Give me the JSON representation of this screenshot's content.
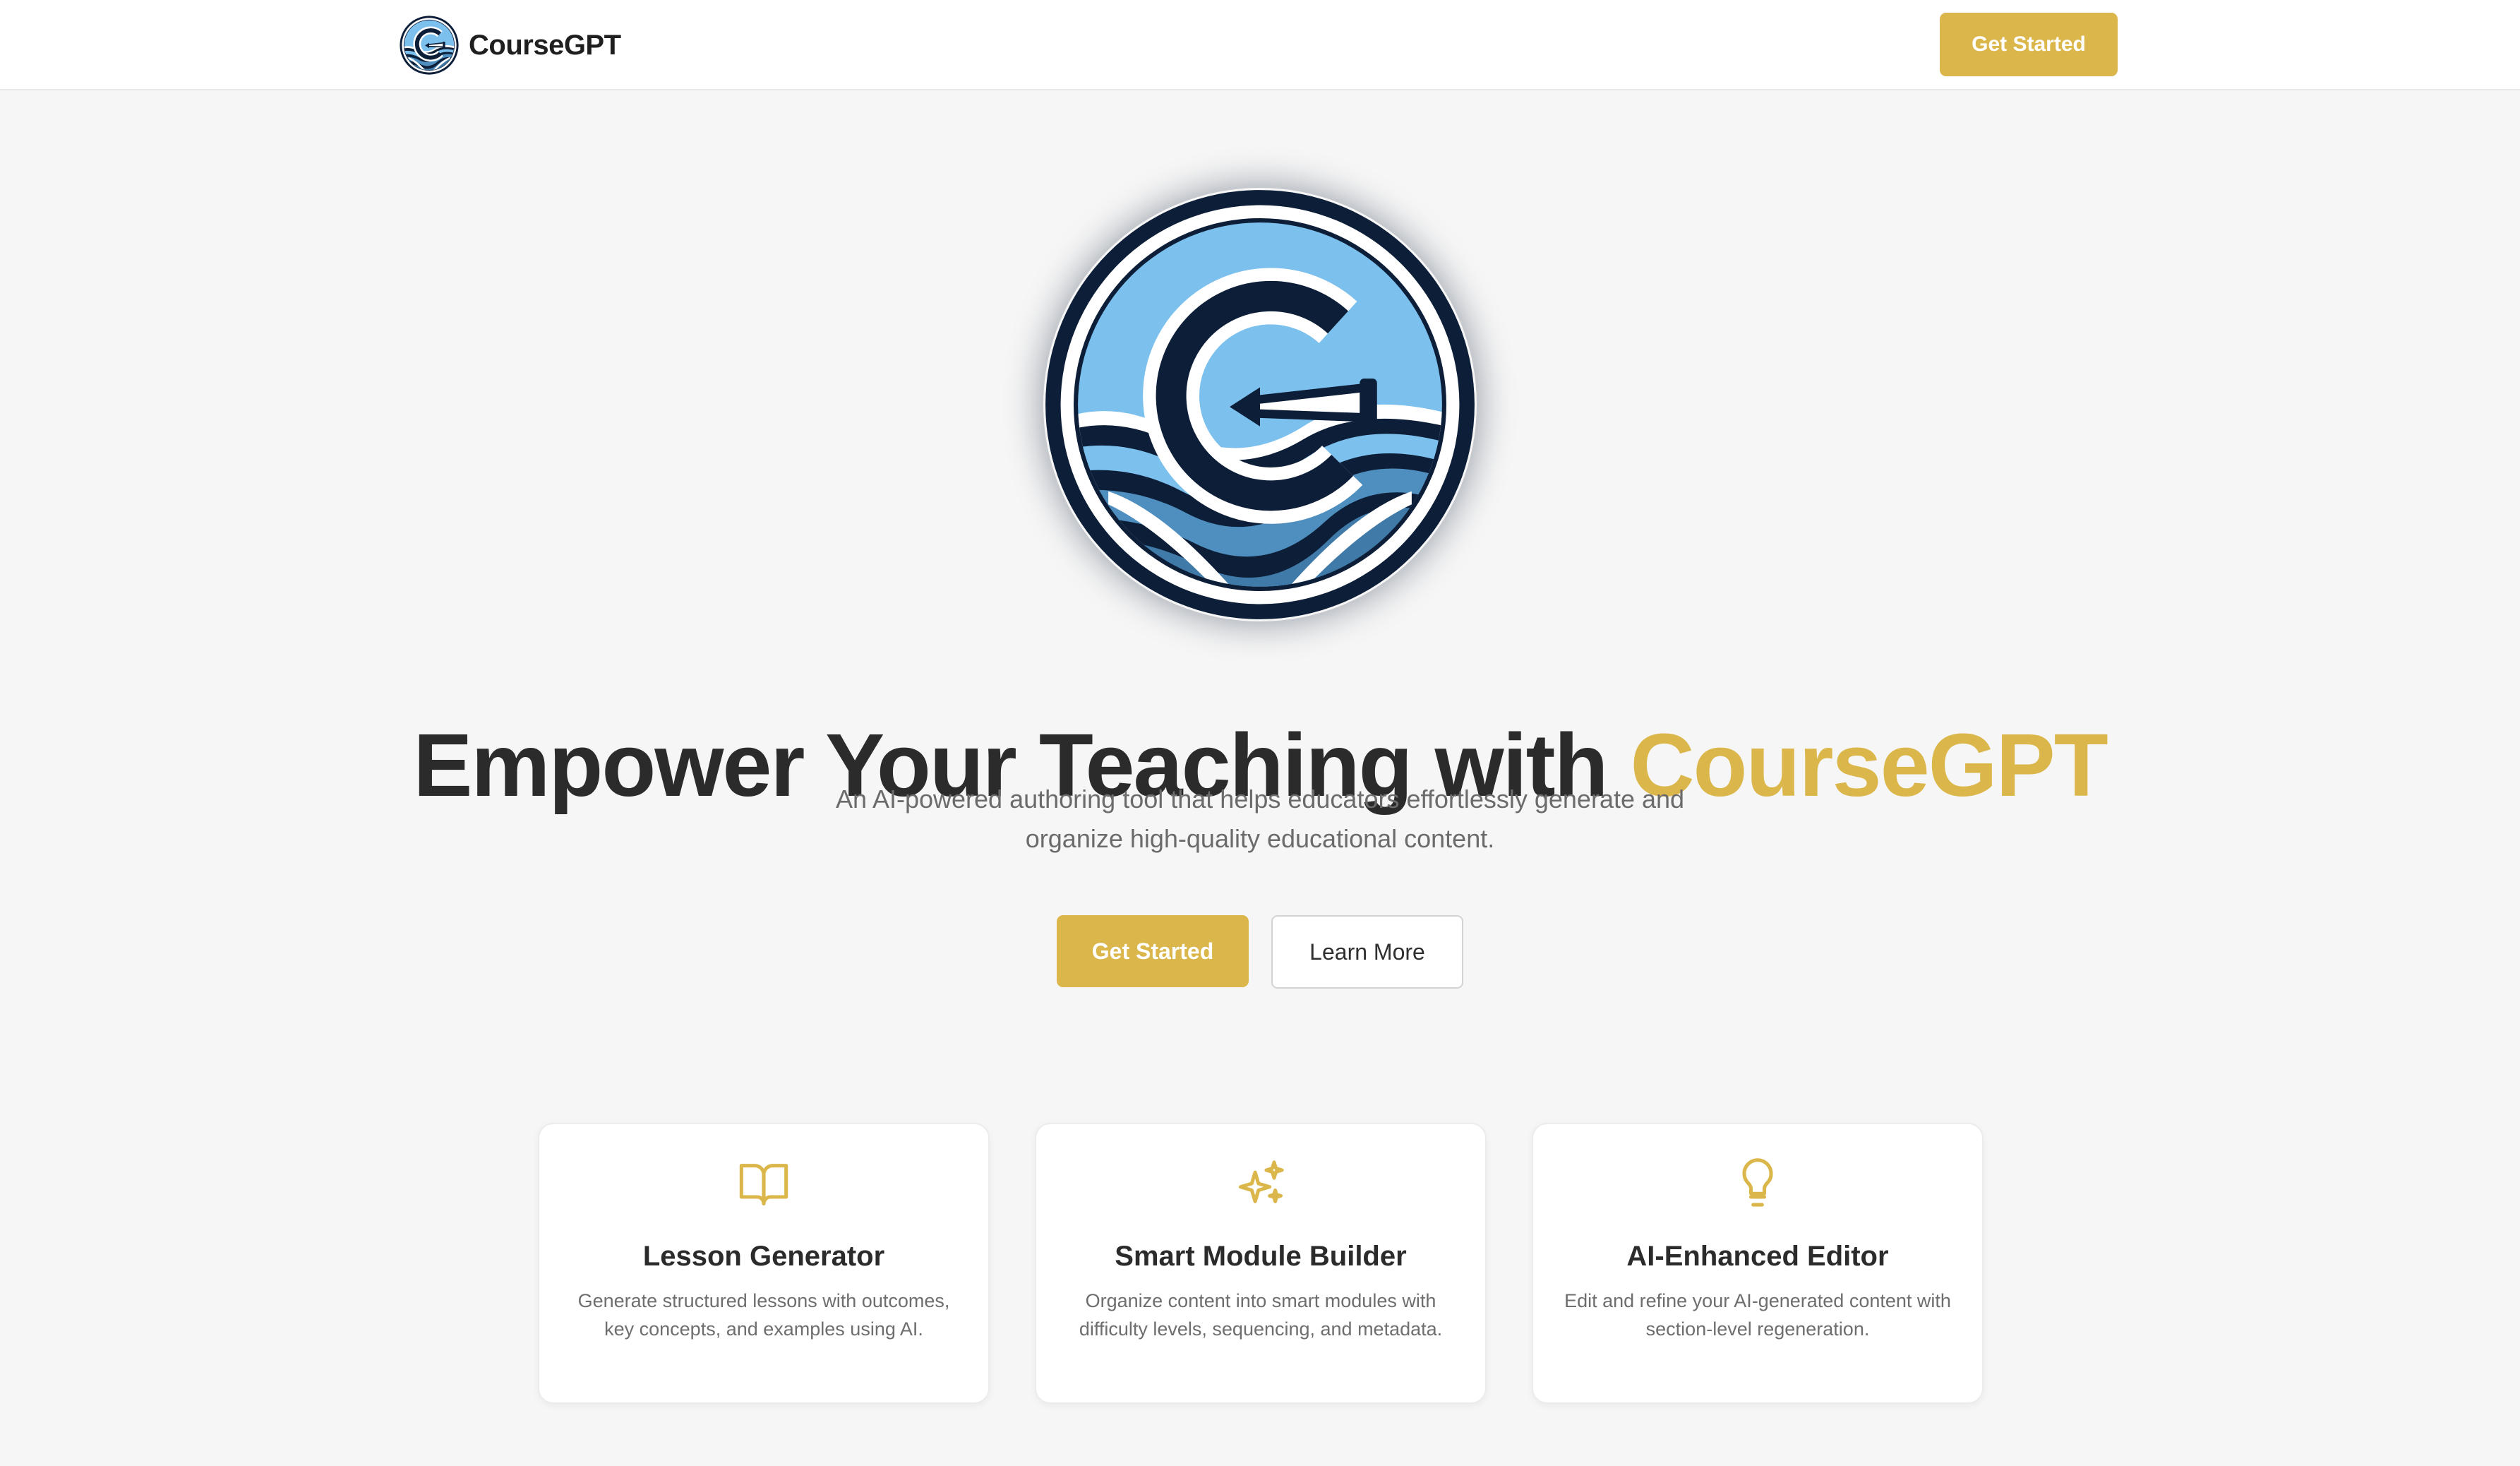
{
  "header": {
    "brand_name": "CourseGPT",
    "brand_logo_icon": "coursegpt-logo",
    "cta_label": "Get Started"
  },
  "hero": {
    "logo_icon": "coursegpt-logo",
    "title_main": "Empower Your Teaching with ",
    "title_accent": "CourseGPT",
    "subtitle": "An AI-powered authoring tool that helps educators effortlessly generate and organize high-quality educational content.",
    "primary_label": "Get Started",
    "secondary_label": "Learn More"
  },
  "features": [
    {
      "icon": "book-open-icon",
      "title": "Lesson Generator",
      "description": "Generate structured lessons with outcomes, key concepts, and examples using AI."
    },
    {
      "icon": "sparkles-icon",
      "title": "Smart Module Builder",
      "description": "Organize content into smart modules with difficulty levels, sequencing, and metadata."
    },
    {
      "icon": "lightbulb-icon",
      "title": "AI-Enhanced Editor",
      "description": "Edit and refine your AI-generated content with section-level regeneration."
    }
  ],
  "colors": {
    "accent": "#dbb74b",
    "navy": "#0d1f38",
    "sky": "#7cc0ee",
    "background": "#f6f6f6"
  }
}
